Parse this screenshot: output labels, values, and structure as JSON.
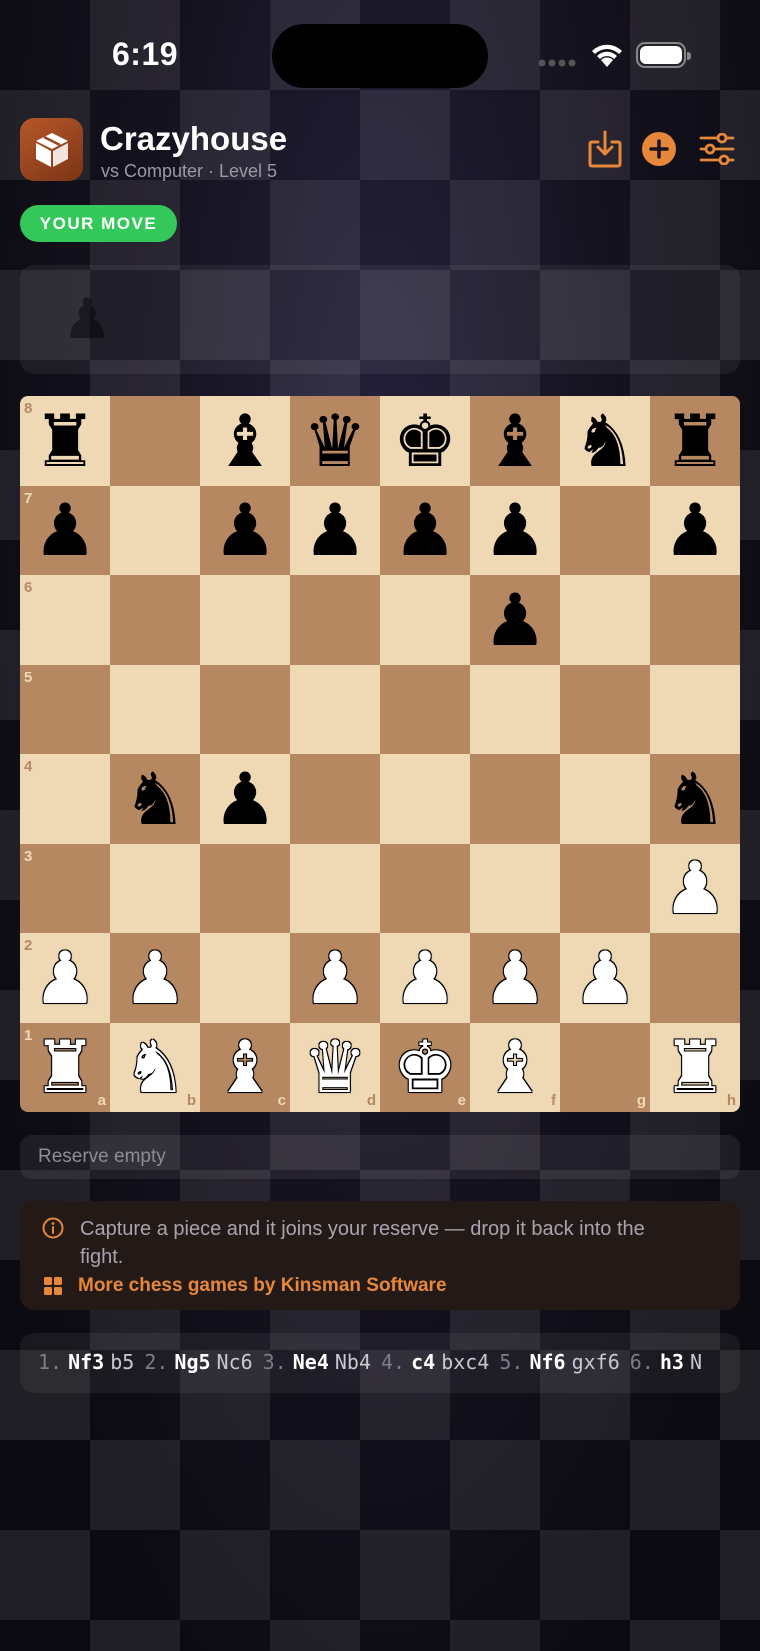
{
  "status": {
    "time": "6:19"
  },
  "header": {
    "title": "Crazyhouse",
    "subtitle": "vs Computer · Level 5"
  },
  "badge": "YOUR MOVE",
  "reserve_top_ghost": "♟",
  "board": {
    "ranks": [
      "8",
      "7",
      "6",
      "5",
      "4",
      "3",
      "2",
      "1"
    ],
    "files": [
      "a",
      "b",
      "c",
      "d",
      "e",
      "f",
      "g",
      "h"
    ],
    "rows": [
      [
        "bR",
        "",
        "bB",
        "bQ",
        "bK",
        "bB",
        "bN",
        "bR"
      ],
      [
        "bP",
        "",
        "bP",
        "bP",
        "bP",
        "bP",
        "",
        "bP"
      ],
      [
        "",
        "",
        "",
        "",
        "",
        "bP",
        "",
        ""
      ],
      [
        "",
        "",
        "",
        "",
        "",
        "",
        "",
        ""
      ],
      [
        "",
        "bN",
        "bP",
        "",
        "",
        "",
        "",
        "bN"
      ],
      [
        "",
        "",
        "",
        "",
        "",
        "",
        "",
        "wP"
      ],
      [
        "wP",
        "wP",
        "",
        "wP",
        "wP",
        "wP",
        "wP",
        ""
      ],
      [
        "wR",
        "wN",
        "wB",
        "wQ",
        "wK",
        "wB",
        "",
        "wR"
      ]
    ]
  },
  "reserve_bottom": "Reserve empty",
  "info": {
    "message": "Capture a piece and it joins your reserve — drop it back into the fight.",
    "link": "More chess games by Kinsman Software"
  },
  "moves": [
    {
      "n": "1.",
      "w": "Nf3",
      "b": "b5"
    },
    {
      "n": "2.",
      "w": "Ng5",
      "b": "Nc6"
    },
    {
      "n": "3.",
      "w": "Ne4",
      "b": "Nb4"
    },
    {
      "n": "4.",
      "w": "c4",
      "b": "bxc4"
    },
    {
      "n": "5.",
      "w": "Nf6",
      "b": "gxf6"
    },
    {
      "n": "6.",
      "w": "h3",
      "b": "N"
    }
  ],
  "colors": {
    "accent": "#e7873a",
    "badge": "#34c759",
    "light_square": "#efd9b5",
    "dark_square": "#b68862"
  }
}
